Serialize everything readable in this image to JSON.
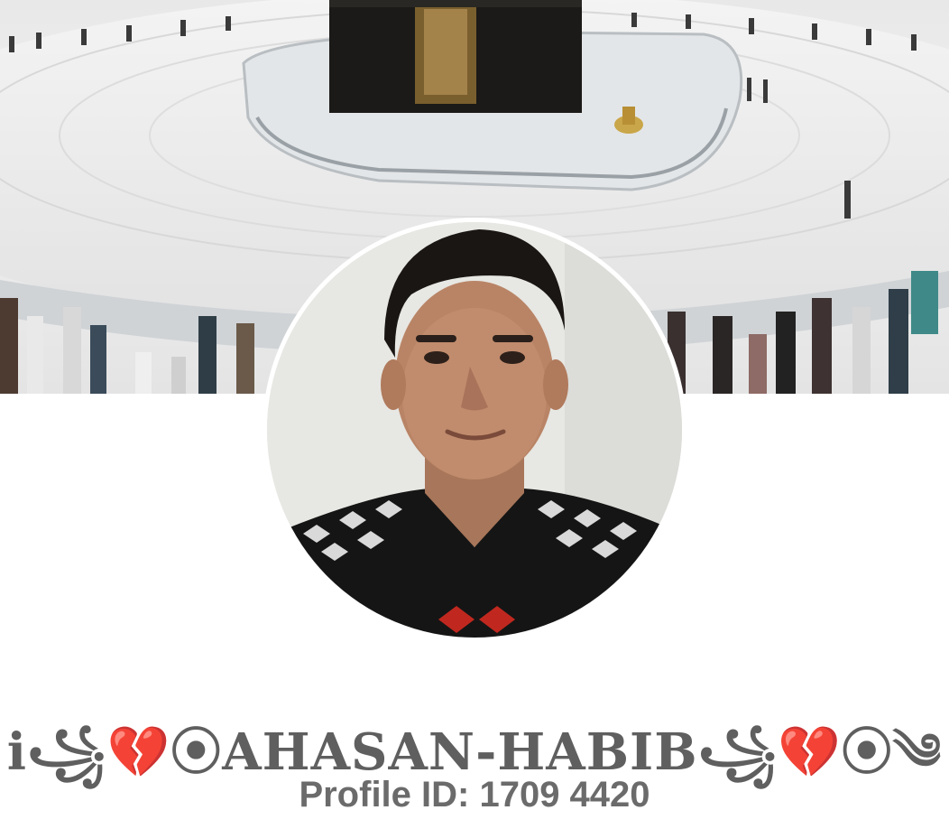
{
  "profile": {
    "cover_photo": "kaaba-cover-photo",
    "avatar": "profile-photo",
    "name": "i꧁💔⦿AHASAN-HABIB꧁💔⦿༄",
    "profile_id": "Profile ID: 1709 4420"
  }
}
